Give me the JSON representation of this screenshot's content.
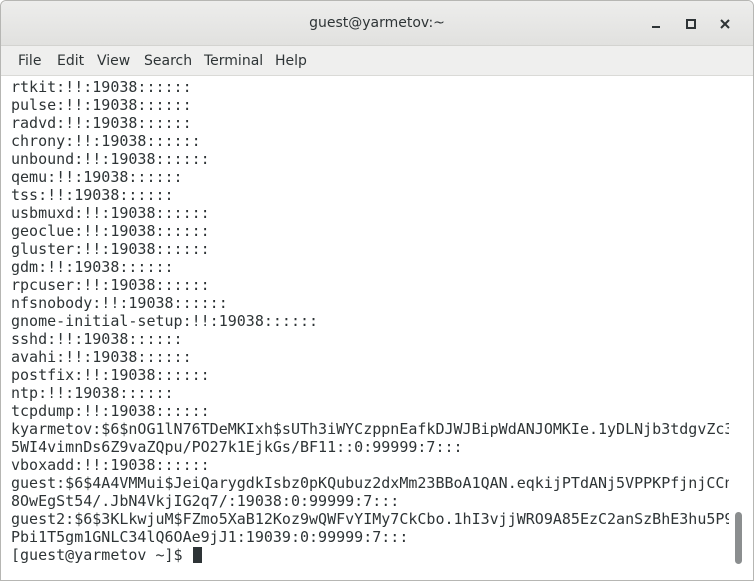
{
  "window": {
    "title": "guest@yarmetov:~"
  },
  "menubar": {
    "items": [
      "File",
      "Edit",
      "View",
      "Search",
      "Terminal",
      "Help"
    ]
  },
  "terminal": {
    "lines": [
      "rtkit:!!:19038::::::",
      "pulse:!!:19038::::::",
      "radvd:!!:19038::::::",
      "chrony:!!:19038::::::",
      "unbound:!!:19038::::::",
      "qemu:!!:19038::::::",
      "tss:!!:19038::::::",
      "usbmuxd:!!:19038::::::",
      "geoclue:!!:19038::::::",
      "gluster:!!:19038::::::",
      "gdm:!!:19038::::::",
      "rpcuser:!!:19038::::::",
      "nfsnobody:!!:19038::::::",
      "gnome-initial-setup:!!:19038::::::",
      "sshd:!!:19038::::::",
      "avahi:!!:19038::::::",
      "postfix:!!:19038::::::",
      "ntp:!!:19038::::::",
      "tcpdump:!!:19038::::::",
      "kyarmetov:$6$nOG1lN76TDeMKIxh$sUTh3iWYCzppnEafkDJWJBipWdANJOMKIe.1yDLNjb3tdgvZc3",
      "5WI4vimnDs6Z9vaZQpu/PO27k1EjkGs/BF11::0:99999:7:::",
      "vboxadd:!!:19038::::::",
      "guest:$6$4A4VMMui$JeiQarygdkIsbz0pKQubuz2dxMm23BBoA1QAN.eqkijPTdANj5VPPKPfjnjCCn",
      "8OwEgSt54/.JbN4VkjIG2q7/:19038:0:99999:7:::",
      "guest2:$6$3KLkwjuM$FZmo5XaB12Koz9wQWFvYIMy7CkCbo.1hI3vjjWRO9A85EzC2anSzBhE3hu5P9",
      "Pbi1T5gm1GNLC34lQ6OAe9jJ1:19039:0:99999:7:::"
    ],
    "prompt": "[guest@yarmetov ~]$ "
  },
  "icons": {
    "minimize": "minimize-icon",
    "maximize": "maximize-icon",
    "close": "close-icon"
  },
  "colors": {
    "text": "#2e3436",
    "titlebar": "#e8e8e7",
    "background": "#ffffff"
  }
}
